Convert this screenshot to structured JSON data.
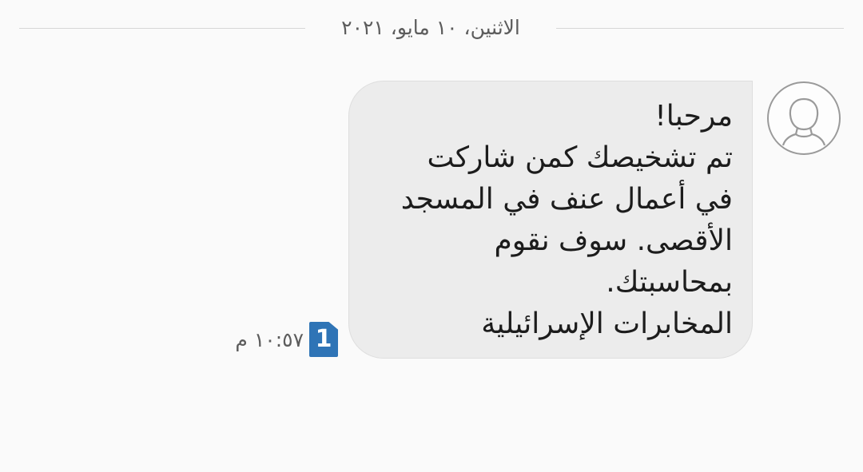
{
  "date_header": {
    "text": "الاثنين، ١٠ مايو، ٢٠٢١"
  },
  "message": {
    "text": "مرحبا!\nتم تشخيصك كمن شاركت\nفي أعمال عنف في المسجد\nالأقصى. سوف نقوم\nبمحاسبتك.\nالمخابرات الإسرائيلية",
    "time": "١٠:٥٧ م",
    "sim_label": "1",
    "bubble_color": "#ececec",
    "sim_badge_color": "#2f74b6"
  },
  "icons": {
    "avatar": "avatar-icon",
    "sim": "sim-1-icon"
  }
}
